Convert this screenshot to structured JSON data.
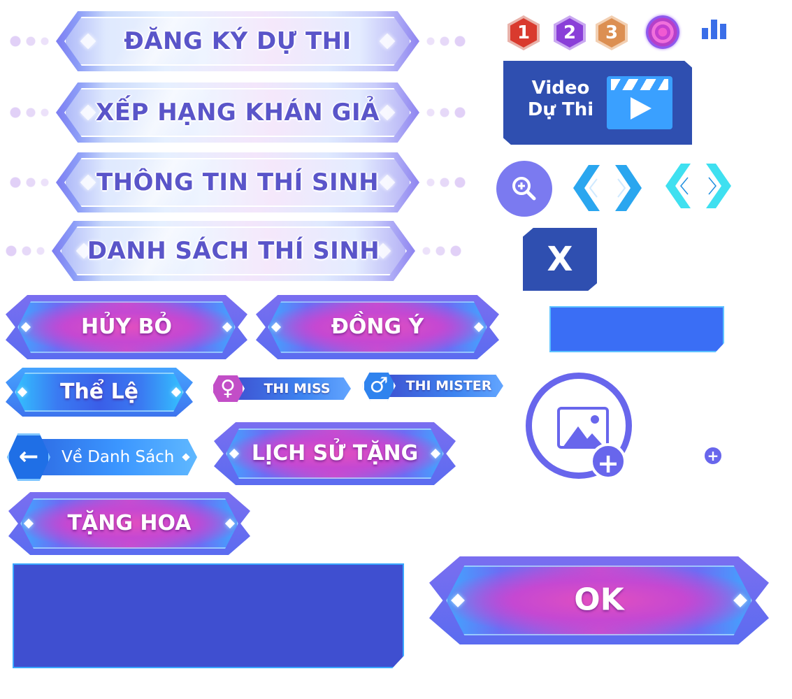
{
  "banners": [
    {
      "label": "ĐĂNG KÝ DỰ THI"
    },
    {
      "label": "XẾP HẠNG KHÁN GIẢ"
    },
    {
      "label": "THÔNG TIN THÍ SINH"
    },
    {
      "label": "DANH SÁCH THÍ SINH"
    }
  ],
  "buttons": {
    "cancel": "HỦY BỎ",
    "agree": "ĐỒNG Ý",
    "rules": "Thể Lệ",
    "thi_miss": "THI MISS",
    "thi_mister": "THI MISTER",
    "back_to_list": "Về Danh Sách",
    "gift_history": "LỊCH SỬ TẶNG",
    "give_flower": "TẶNG HOA",
    "ok": "OK"
  },
  "ranks": {
    "first": "1",
    "second": "2",
    "third": "3"
  },
  "video_card": {
    "line1": "Video",
    "line2": "Dự Thi"
  },
  "close_label": "X",
  "colors": {
    "primary": "#2f4fb0",
    "accent_purple": "#6866ec",
    "pink": "#d24cc8",
    "blue": "#3a7bf2",
    "rank1": "#d93a2e",
    "rank2": "#8a3fd8",
    "rank3": "#dc8f52"
  },
  "icons": [
    "rank-1-icon",
    "rank-2-icon",
    "rank-3-icon",
    "rose-icon",
    "bar-chart-icon",
    "zoom-in-icon",
    "chevron-left-icon",
    "chevron-right-icon",
    "female-icon",
    "male-icon",
    "arrow-left-icon",
    "image-icon",
    "plus-icon",
    "clapperboard-icon"
  ]
}
